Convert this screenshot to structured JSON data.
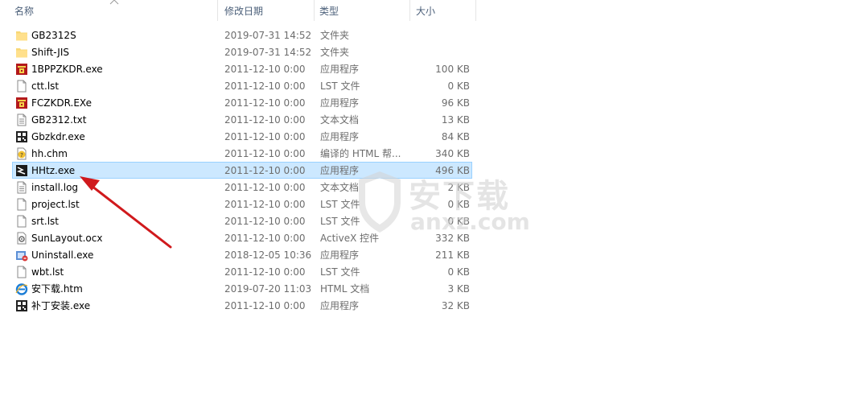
{
  "columns": {
    "name": "名称",
    "date": "修改日期",
    "type": "类型",
    "size": "大小"
  },
  "files": [
    {
      "name": "GB2312S",
      "date": "2019-07-31 14:52",
      "type": "文件夹",
      "size": "",
      "icon": "folder-icon"
    },
    {
      "name": "Shift-JIS",
      "date": "2019-07-31 14:52",
      "type": "文件夹",
      "size": "",
      "icon": "folder-icon"
    },
    {
      "name": "1BPPZKDR.exe",
      "date": "2011-12-10 0:00",
      "type": "应用程序",
      "size": "100 KB",
      "icon": "red-app-icon"
    },
    {
      "name": "ctt.lst",
      "date": "2011-12-10 0:00",
      "type": "LST 文件",
      "size": "0 KB",
      "icon": "file-icon"
    },
    {
      "name": "FCZKDR.EXe",
      "date": "2011-12-10 0:00",
      "type": "应用程序",
      "size": "96 KB",
      "icon": "red-app-icon"
    },
    {
      "name": "GB2312.txt",
      "date": "2011-12-10 0:00",
      "type": "文本文档",
      "size": "13 KB",
      "icon": "text-file-icon"
    },
    {
      "name": "Gbzkdr.exe",
      "date": "2011-12-10 0:00",
      "type": "应用程序",
      "size": "84 KB",
      "icon": "pattern-app-icon"
    },
    {
      "name": "hh.chm",
      "date": "2011-12-10 0:00",
      "type": "编译的 HTML 帮...",
      "size": "340 KB",
      "icon": "help-file-icon"
    },
    {
      "name": "HHtz.exe",
      "date": "2011-12-10 0:00",
      "type": "应用程序",
      "size": "496 KB",
      "icon": "tool-app-icon",
      "selected": true
    },
    {
      "name": "install.log",
      "date": "2011-12-10 0:00",
      "type": "文本文档",
      "size": "2 KB",
      "icon": "text-file-icon"
    },
    {
      "name": "project.lst",
      "date": "2011-12-10 0:00",
      "type": "LST 文件",
      "size": "0 KB",
      "icon": "file-icon"
    },
    {
      "name": "srt.lst",
      "date": "2011-12-10 0:00",
      "type": "LST 文件",
      "size": "0 KB",
      "icon": "file-icon"
    },
    {
      "name": "SunLayout.ocx",
      "date": "2011-12-10 0:00",
      "type": "ActiveX 控件",
      "size": "332 KB",
      "icon": "activex-icon"
    },
    {
      "name": "Uninstall.exe",
      "date": "2018-12-05 10:36",
      "type": "应用程序",
      "size": "211 KB",
      "icon": "uninstall-icon"
    },
    {
      "name": "wbt.lst",
      "date": "2011-12-10 0:00",
      "type": "LST 文件",
      "size": "0 KB",
      "icon": "file-icon"
    },
    {
      "name": "安下载.htm",
      "date": "2019-07-20 11:03",
      "type": "HTML 文档",
      "size": "3 KB",
      "icon": "ie-html-icon"
    },
    {
      "name": "补丁安装.exe",
      "date": "2011-12-10 0:00",
      "type": "应用程序",
      "size": "32 KB",
      "icon": "pattern-app-icon"
    }
  ],
  "watermark": {
    "title": "安下载",
    "domain": "anxz.com"
  },
  "colors": {
    "selection_bg": "#cce8ff",
    "selection_border": "#99d1ff",
    "header_text": "#4c607a",
    "meta_text": "#6d6d6d",
    "annotation_arrow": "#d0191c"
  }
}
